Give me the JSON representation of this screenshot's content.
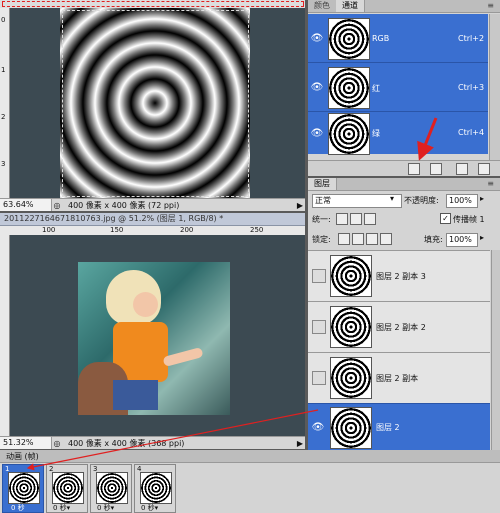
{
  "top_doc": {
    "zoom": "63.64%",
    "info": "400 像素 x 400 像素 (72 ppi)",
    "ruler_v": [
      "0",
      "1",
      "2",
      "3"
    ]
  },
  "bottom_doc": {
    "title": "2011227164671810763.jpg @ 51.2% (图层 1, RGB/8) *",
    "ruler_h": [
      "100",
      "150",
      "200",
      "250"
    ],
    "zoom": "51.32%",
    "info": "400 像素 x 400 像素 (368 ppi)"
  },
  "channels_panel": {
    "tabs": [
      "颜色",
      "通道"
    ],
    "channels": [
      {
        "name": "RGB",
        "shortcut": "Ctrl+2"
      },
      {
        "name": "红",
        "shortcut": "Ctrl+3"
      },
      {
        "name": "绿",
        "shortcut": "Ctrl+4"
      }
    ]
  },
  "layers_panel": {
    "tab": "图层",
    "blend_mode": "正常",
    "opacity_label": "不透明度:",
    "opacity_value": "100%",
    "unify_label": "统一:",
    "propagate_label": "传播帧 1",
    "lock_label": "锁定:",
    "fill_label": "填充:",
    "fill_value": "100%",
    "layers": [
      {
        "name": "图层 2 副本 3"
      },
      {
        "name": "图层 2 副本 2"
      },
      {
        "name": "图层 2 副本"
      },
      {
        "name": "图层 2"
      }
    ]
  },
  "animation_panel": {
    "title": "动画 (帧)",
    "frames": [
      {
        "num": "1",
        "delay": "0 秒"
      },
      {
        "num": "2",
        "delay": "0 秒▾"
      },
      {
        "num": "3",
        "delay": "0 秒▾"
      },
      {
        "num": "4",
        "delay": "0 秒▾"
      }
    ]
  },
  "colors": {
    "selected": "#3a6fd0",
    "arrow": "#e02020"
  }
}
